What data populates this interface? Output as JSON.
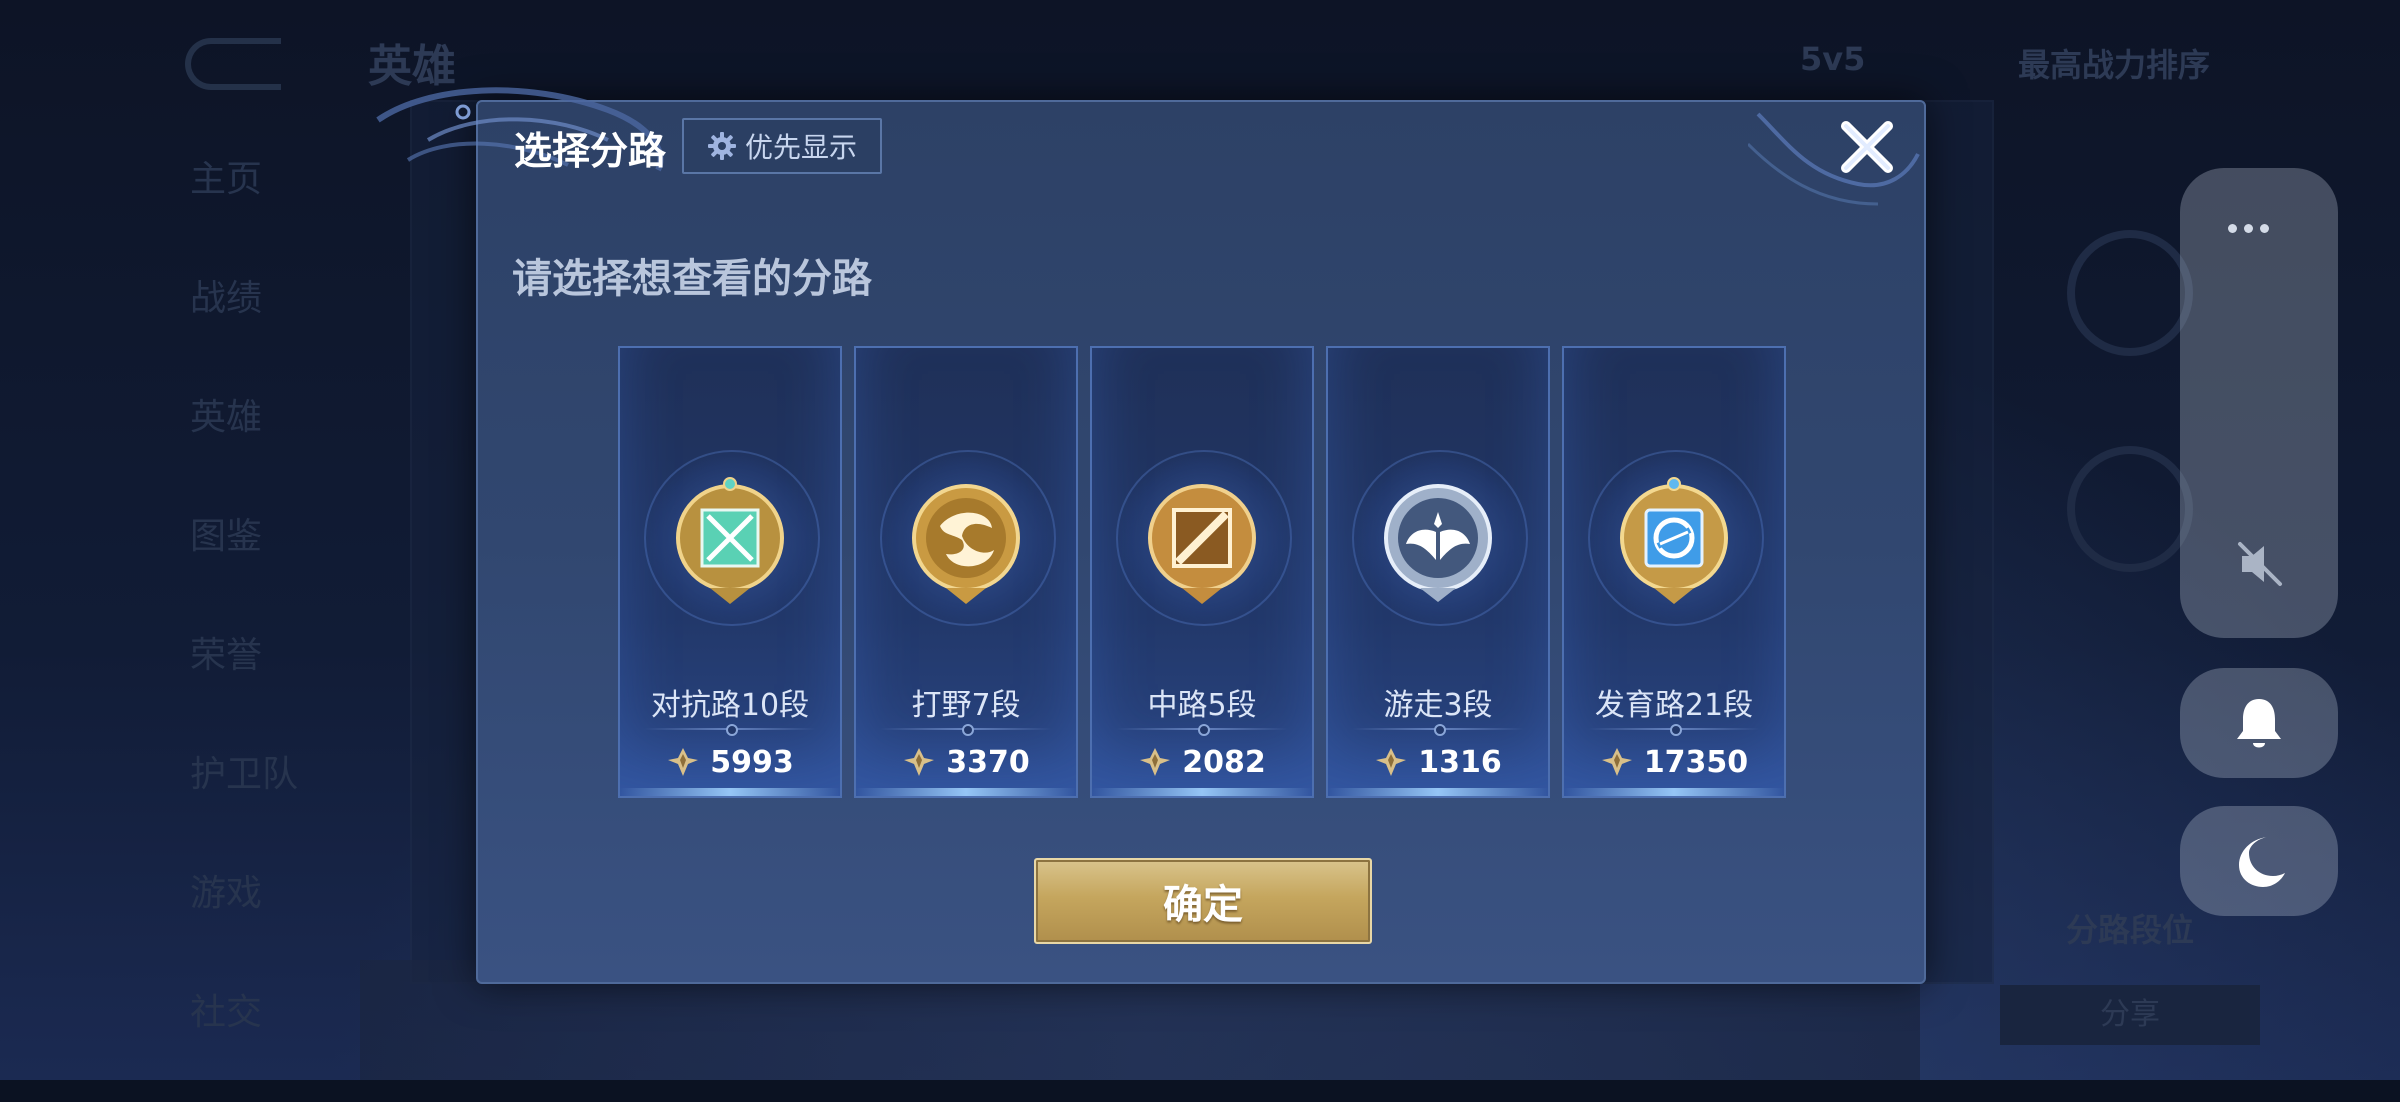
{
  "background": {
    "title": "英雄",
    "mode": "5v5",
    "sort": "最高战力排序",
    "side_items": [
      "主页",
      "战绩",
      "英雄",
      "图鉴",
      "荣誉",
      "护卫队",
      "游戏",
      "社交"
    ],
    "right_button": "分路段位",
    "share_button": "分享"
  },
  "dialog": {
    "title": "选择分路",
    "priority_button": "优先显示",
    "subtitle": "请选择想查看的分路",
    "confirm": "确定",
    "lanes": [
      {
        "label": "对抗路10段",
        "score": "5993",
        "emblem": "clash-lane-emblem-icon",
        "color": "#4fcfb0"
      },
      {
        "label": "打野7段",
        "score": "3370",
        "emblem": "jungle-emblem-icon",
        "color": "#d7a64a"
      },
      {
        "label": "中路5段",
        "score": "2082",
        "emblem": "mid-lane-emblem-icon",
        "color": "#d39a4c"
      },
      {
        "label": "游走3段",
        "score": "1316",
        "emblem": "roam-emblem-icon",
        "color": "#c9d6ea"
      },
      {
        "label": "发育路21段",
        "score": "17350",
        "emblem": "farm-lane-emblem-icon",
        "color": "#4aa8f0"
      }
    ]
  },
  "colors": {
    "accent_gold": "#c5a65e",
    "dialog_bg": "#314770",
    "card_border": "#4d6fb0"
  },
  "system_panel": {
    "icons": [
      "more-dots-icon",
      "mute-icon",
      "bell-icon",
      "moon-icon"
    ]
  }
}
